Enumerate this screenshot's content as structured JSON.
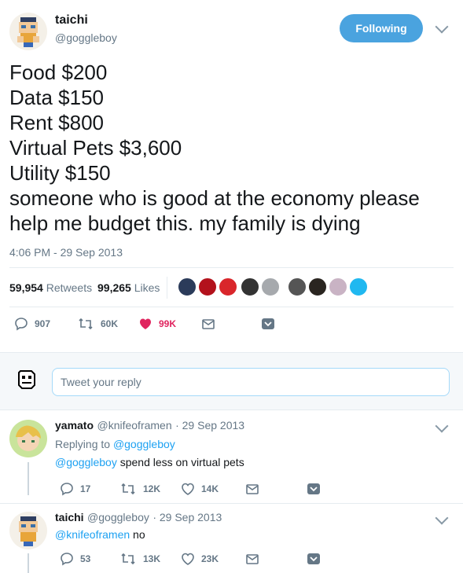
{
  "tweet": {
    "author_name": "taichi",
    "author_handle": "@goggleboy",
    "follow_label": "Following",
    "lines": [
      "Food $200",
      "Data $150",
      "Rent $800",
      "Virtual Pets $3,600",
      "Utility $150",
      "someone who is good at the economy please",
      "help me budget this. my family is dying"
    ],
    "timestamp": "4:06 PM - 29 Sep 2013",
    "retweets_count": "59,954",
    "retweets_label": "Retweets",
    "likes_count": "99,265",
    "likes_label": "Likes",
    "actions": {
      "replies": "907",
      "retweets": "60K",
      "likes": "99K"
    }
  },
  "reply_box": {
    "placeholder": "Tweet your reply"
  },
  "replies": [
    {
      "name": "yamato",
      "handle": "@knifeoframen",
      "date": "· 29 Sep 2013",
      "replying_prefix": "Replying to",
      "replying_to": "@goggleboy",
      "mention": "@goggleboy",
      "text": "spend less on virtual pets",
      "replies": "17",
      "retweets": "12K",
      "likes": "14K"
    },
    {
      "name": "taichi",
      "handle": "@goggleboy",
      "date": "· 29 Sep 2013",
      "mention": "@knifeoframen",
      "text": "no",
      "replies": "53",
      "retweets": "13K",
      "likes": "23K"
    }
  ],
  "colors": {
    "accent": "#1da1f2",
    "follow_button": "#4aa3df",
    "like_red": "#e0245e",
    "muted": "#657786"
  },
  "icons": [
    "reply-icon",
    "retweet-icon",
    "heart-icon",
    "dm-icon",
    "chevron-down-icon"
  ]
}
